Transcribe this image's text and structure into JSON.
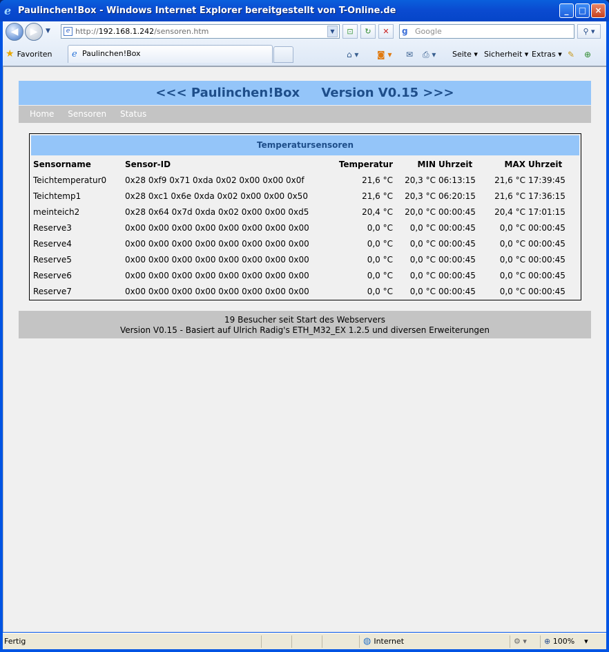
{
  "window": {
    "title": "Paulinchen!Box - Windows Internet Explorer bereitgestellt von T-Online.de",
    "minimize": "_",
    "maximize": "□",
    "close": "×"
  },
  "address": {
    "prefix": "http://",
    "host": "192.168.1.242",
    "path": "/sensoren.htm"
  },
  "search": {
    "placeholder": "Google"
  },
  "favorites": {
    "label": "Favoriten"
  },
  "tab": {
    "title": "Paulinchen!Box"
  },
  "commandbar": {
    "page": "Seite",
    "security": "Sicherheit",
    "extras": "Extras"
  },
  "page": {
    "header": "<<< Paulinchen!Box     Version V0.15 >>>",
    "menu": [
      "Home",
      "Sensoren",
      "Status"
    ],
    "table_caption": "Temperatursensoren",
    "columns": [
      "Sensorname",
      "Sensor-ID",
      "Temperatur",
      "MIN",
      "Uhrzeit",
      "MAX",
      "Uhrzeit"
    ],
    "rows": [
      [
        "Teichtemperatur0",
        "0x28 0xf9 0x71 0xda 0x02 0x00 0x00 0x0f",
        "21,6 °C",
        "20,3 °C",
        "06:13:15",
        "21,6 °C",
        "17:39:45"
      ],
      [
        "Teichtemp1",
        "0x28 0xc1 0x6e 0xda 0x02 0x00 0x00 0x50",
        "21,6 °C",
        "20,3 °C",
        "06:20:15",
        "21,6 °C",
        "17:36:15"
      ],
      [
        "meinteich2",
        "0x28 0x64 0x7d 0xda 0x02 0x00 0x00 0xd5",
        "20,4 °C",
        "20,0 °C",
        "00:00:45",
        "20,4 °C",
        "17:01:15"
      ],
      [
        "Reserve3",
        "0x00 0x00 0x00 0x00 0x00 0x00 0x00 0x00",
        "0,0 °C",
        "0,0 °C",
        "00:00:45",
        "0,0 °C",
        "00:00:45"
      ],
      [
        "Reserve4",
        "0x00 0x00 0x00 0x00 0x00 0x00 0x00 0x00",
        "0,0 °C",
        "0,0 °C",
        "00:00:45",
        "0,0 °C",
        "00:00:45"
      ],
      [
        "Reserve5",
        "0x00 0x00 0x00 0x00 0x00 0x00 0x00 0x00",
        "0,0 °C",
        "0,0 °C",
        "00:00:45",
        "0,0 °C",
        "00:00:45"
      ],
      [
        "Reserve6",
        "0x00 0x00 0x00 0x00 0x00 0x00 0x00 0x00",
        "0,0 °C",
        "0,0 °C",
        "00:00:45",
        "0,0 °C",
        "00:00:45"
      ],
      [
        "Reserve7",
        "0x00 0x00 0x00 0x00 0x00 0x00 0x00 0x00",
        "0,0 °C",
        "0,0 °C",
        "00:00:45",
        "0,0 °C",
        "00:00:45"
      ]
    ],
    "footer_line1": "19 Besucher seit Start des Webservers",
    "footer_line2": "Version V0.15 - Basiert auf Ulrich Radig's ETH_M32_EX 1.2.5 und diversen Erweiterungen"
  },
  "status": {
    "left": "Fertig",
    "zone": "Internet",
    "zoom": "100%"
  },
  "colors": {
    "header_bg": "#94c5f9",
    "header_text": "#1e4e8a",
    "menu_bg": "#c4c4c4"
  }
}
